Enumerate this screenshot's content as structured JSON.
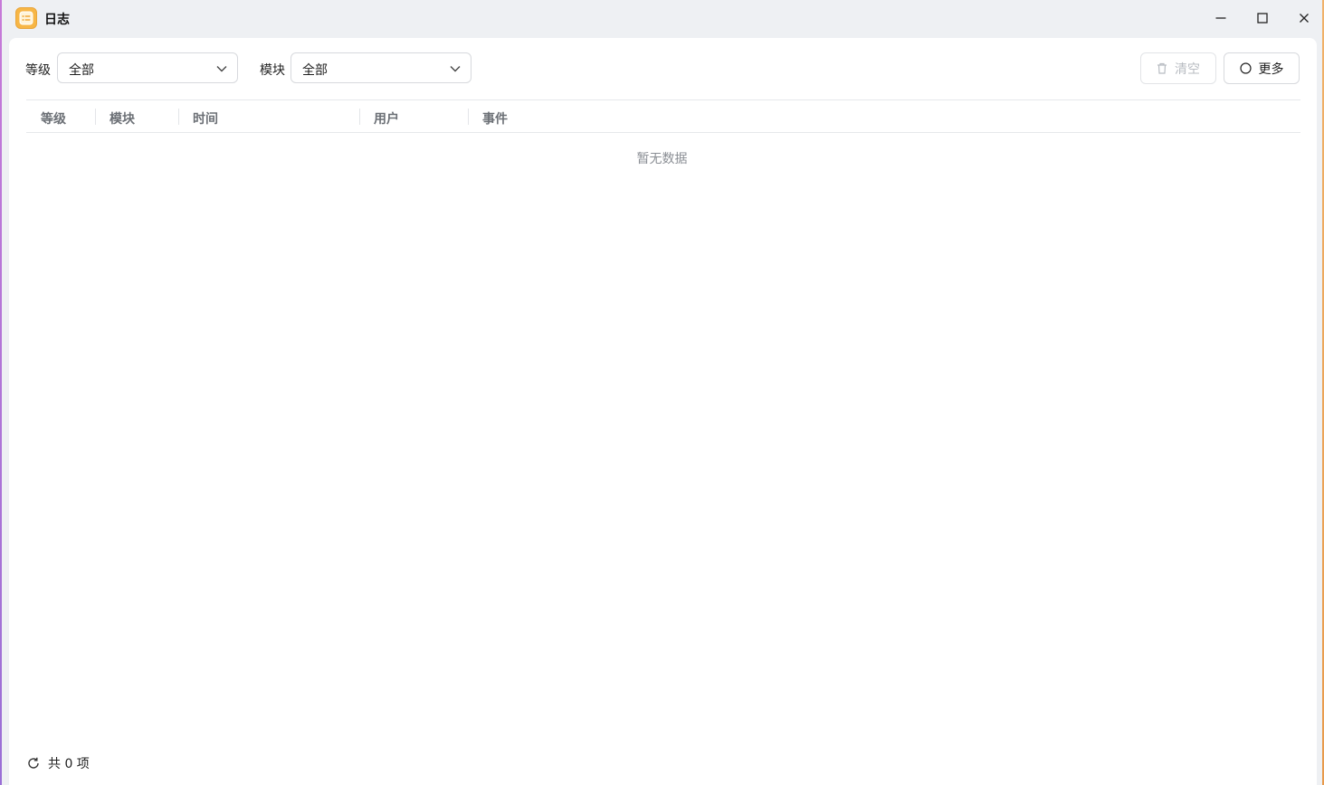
{
  "window": {
    "title": "日志",
    "app_icon": "log-app-icon"
  },
  "window_controls": {
    "minimize_icon": "minimize-icon",
    "maximize_icon": "maximize-icon",
    "close_icon": "close-icon"
  },
  "filters": {
    "level": {
      "label": "等级",
      "value": "全部"
    },
    "module": {
      "label": "模块",
      "value": "全部"
    }
  },
  "toolbar": {
    "clear_label": "清空",
    "clear_icon": "trash-icon",
    "clear_enabled": false,
    "more_label": "更多",
    "more_icon": "circle-icon"
  },
  "table": {
    "columns": [
      "等级",
      "模块",
      "时间",
      "用户",
      "事件"
    ],
    "rows": [],
    "empty_text": "暂无数据"
  },
  "footer": {
    "refresh_icon": "refresh-icon",
    "count_text": "共 0 项"
  },
  "colors": {
    "app_icon": "#f7b645",
    "edge_left": "#c77ad8",
    "edge_right": "#f0b26a"
  }
}
